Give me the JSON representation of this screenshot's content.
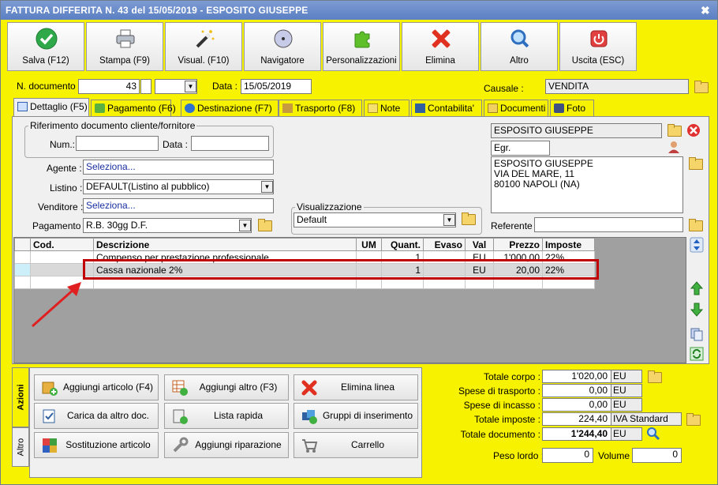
{
  "window": {
    "title": "FATTURA DIFFERITA N. 43 del 15/05/2019 - ESPOSITO GIUSEPPE",
    "close": "✖"
  },
  "toolbar": [
    {
      "label": "Salva (F12)",
      "icon": "check-icon",
      "color": "#2fa84a"
    },
    {
      "label": "Stampa (F9)",
      "icon": "printer-icon",
      "color": "#9aa5b5"
    },
    {
      "label": "Visual. (F10)",
      "icon": "magic-wand-icon",
      "color": "#3a3a3a"
    },
    {
      "label": "Navigatore",
      "icon": "compass-icon",
      "color": "#8c8fb8"
    },
    {
      "label": "Personalizzazioni",
      "icon": "puzzle-icon",
      "color": "#5fbf2a"
    },
    {
      "label": "Elimina",
      "icon": "delete-x-icon",
      "color": "#e03020"
    },
    {
      "label": "Altro",
      "icon": "magnifier-icon",
      "color": "#3f7fd0"
    },
    {
      "label": "Uscita (ESC)",
      "icon": "power-icon",
      "color": "#e04040"
    }
  ],
  "header": {
    "ndoc_label": "N. documento :",
    "ndoc_value": "43",
    "data_label": "Data :",
    "data_value": "15/05/2019",
    "causale_label": "Causale :",
    "causale_value": "VENDITA"
  },
  "tabs": [
    "Dettaglio (F5)",
    "Pagamento (F6)",
    "Destinazione (F7)",
    "Trasporto (F8)",
    "Note",
    "Contabilita'",
    "Documenti",
    "Foto"
  ],
  "riferimento": {
    "legend": "Riferimento documento cliente/fornitore",
    "num_label": "Num.:",
    "data_label": "Data :"
  },
  "fields": {
    "agente_label": "Agente :",
    "agente_value": "Seleziona...",
    "listino_label": "Listino :",
    "listino_value": "DEFAULT(Listino al pubblico)",
    "venditore_label": "Venditore :",
    "venditore_value": "Seleziona...",
    "pagamento_label": "Pagamento :",
    "pagamento_value": "R.B. 30gg D.F.",
    "visualizzazione_legend": "Visualizzazione",
    "visualizzazione_value": "Default"
  },
  "cliente": {
    "name": "ESPOSITO GIUSEPPE",
    "title": "Egr.",
    "address": [
      "ESPOSITO GIUSEPPE",
      "VIA DEL MARE, 11",
      "80100 NAPOLI (NA)"
    ],
    "referente_label": "Referente"
  },
  "grid": {
    "columns": [
      "Cod.",
      "Descrizione",
      "UM",
      "Quant.",
      "Evaso",
      "Val",
      "Prezzo",
      "Imposte"
    ],
    "rows": [
      {
        "cod": "",
        "descrizione": "Compenso per prestazione professionale",
        "um": "",
        "quant": "1",
        "evaso": "",
        "val": "EU",
        "prezzo": "1'000,00",
        "imposte": "22%"
      },
      {
        "cod": "",
        "descrizione": "Cassa nazionale 2%",
        "um": "",
        "quant": "1",
        "evaso": "",
        "val": "EU",
        "prezzo": "20,00",
        "imposte": "22%"
      }
    ]
  },
  "side_tabs": [
    "Azioni",
    "Altro"
  ],
  "actions": [
    {
      "label": "Aggiungi articolo (F4)",
      "icon": "add-article-icon"
    },
    {
      "label": "Aggiungi altro (F3)",
      "icon": "add-other-icon"
    },
    {
      "label": "Elimina linea",
      "icon": "delete-line-icon"
    },
    {
      "label": "Carica da altro doc.",
      "icon": "load-doc-icon"
    },
    {
      "label": "Lista rapida",
      "icon": "quick-list-icon"
    },
    {
      "label": "Gruppi di inserimento",
      "icon": "groups-icon"
    },
    {
      "label": "Sostituzione articolo",
      "icon": "replace-article-icon"
    },
    {
      "label": "Aggiungi riparazione",
      "icon": "repair-icon"
    },
    {
      "label": "Carrello",
      "icon": "cart-icon"
    }
  ],
  "totals": {
    "corpo_label": "Totale corpo :",
    "corpo_value": "1'020,00",
    "corpo_unit": "EU",
    "trasporto_label": "Spese di trasporto :",
    "trasporto_value": "0,00",
    "trasporto_unit": "EU",
    "incasso_label": "Spese di incasso :",
    "incasso_value": "0,00",
    "incasso_unit": "EU",
    "imposte_label": "Totale imposte :",
    "imposte_value": "224,40",
    "imposte_unit": "IVA Standard",
    "documento_label": "Totale documento :",
    "documento_value": "1'244,40",
    "documento_unit": "EU",
    "peso_label": "Peso lordo :",
    "peso_value": "0",
    "volume_label": "Volume :",
    "volume_value": "0"
  }
}
